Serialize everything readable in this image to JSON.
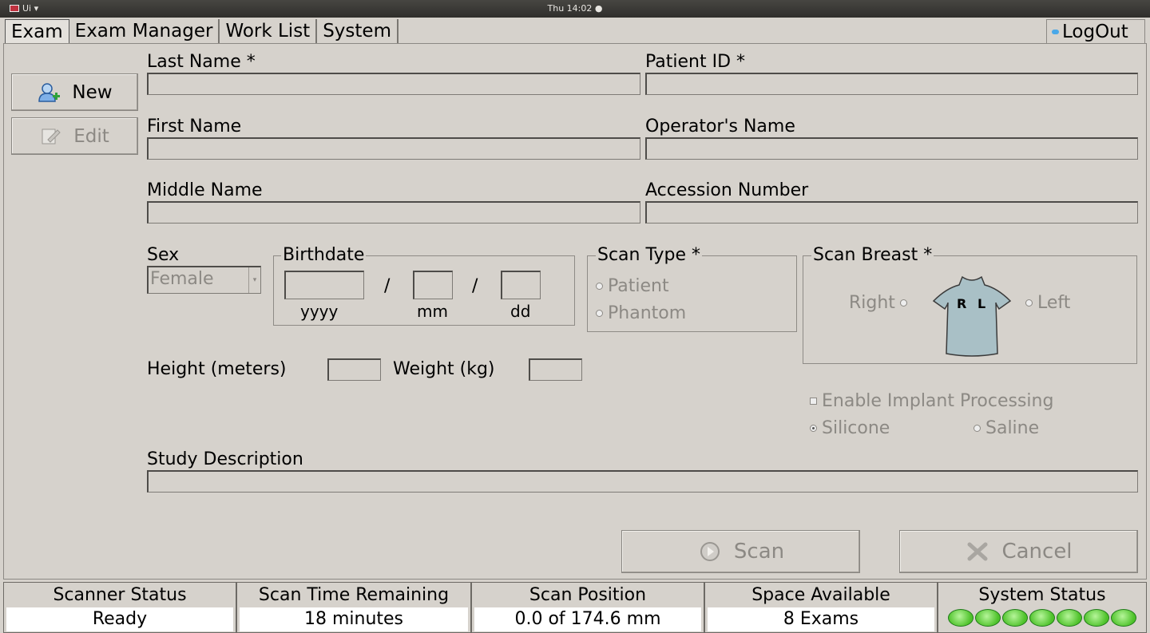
{
  "topbar": {
    "app_label": "Ui ▾",
    "clock": "Thu 14:02 ●"
  },
  "tabs": [
    {
      "label": "Exam",
      "active": true
    },
    {
      "label": "Exam Manager"
    },
    {
      "label": "Work List"
    },
    {
      "label": "System"
    }
  ],
  "logout_label": "LogOut",
  "side_buttons": {
    "new_label": "New",
    "edit_label": "Edit"
  },
  "form": {
    "last_name_label": "Last Name *",
    "patient_id_label": "Patient ID *",
    "first_name_label": "First Name",
    "operator_name_label": "Operator's Name",
    "middle_name_label": "Middle Name",
    "accession_number_label": "Accession Number",
    "sex_label": "Sex",
    "sex_value": "Female",
    "birthdate_label": "Birthdate",
    "birth_sep": "/",
    "yyyy_label": "yyyy",
    "mm_label": "mm",
    "dd_label": "dd",
    "scan_type_label": "Scan Type *",
    "scan_type_options": [
      "Patient",
      "Phantom"
    ],
    "scan_breast_label": "Scan Breast *",
    "right_label": "Right",
    "left_label": "Left",
    "torso_r": "R",
    "torso_l": "L",
    "height_label": "Height (meters)",
    "weight_label": "Weight (kg)",
    "implant_label": "Enable Implant Processing",
    "silicone_label": "Silicone",
    "saline_label": "Saline",
    "study_description_label": "Study Description"
  },
  "actions": {
    "scan_label": "Scan",
    "cancel_label": "Cancel"
  },
  "status": {
    "scanner_status_label": "Scanner Status",
    "scanner_status_value": "Ready",
    "scan_time_label": "Scan Time Remaining",
    "scan_time_value": "18 minutes",
    "scan_position_label": "Scan Position",
    "scan_position_value": "0.0 of 174.6 mm",
    "space_label": "Space Available",
    "space_value": "8 Exams",
    "system_status_label": "System Status",
    "led_count": 7
  },
  "colors": {
    "background": "#d6d2cc",
    "led_green": "#4ec22a",
    "torso": "#a9c0c6"
  }
}
